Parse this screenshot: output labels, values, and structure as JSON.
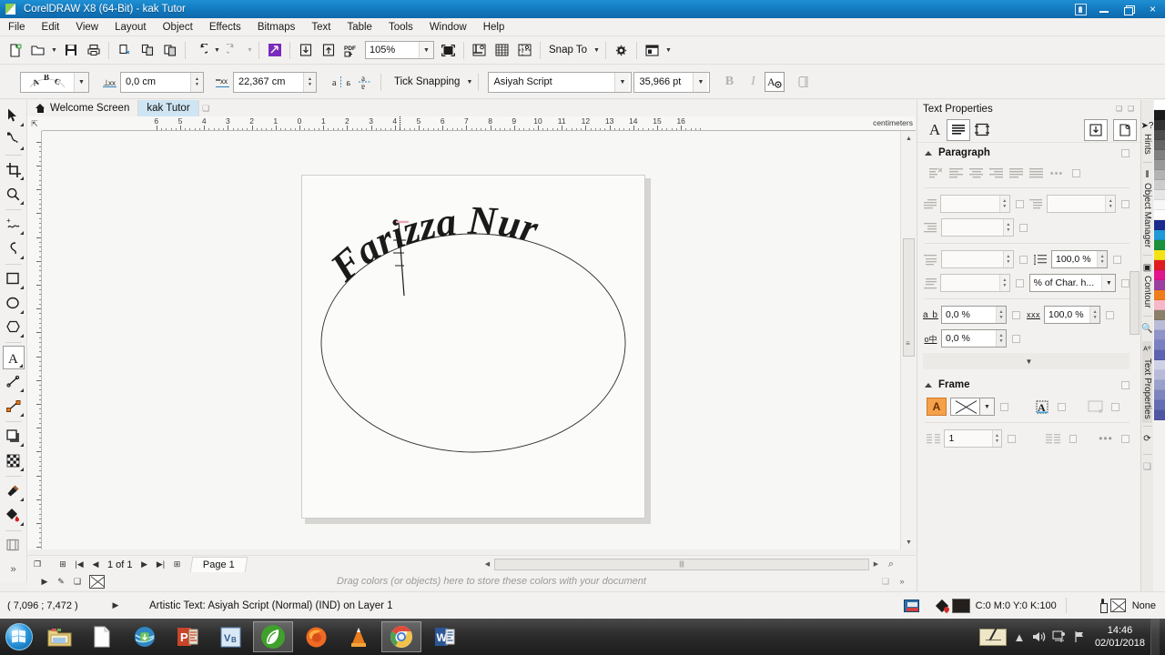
{
  "window": {
    "title": "CorelDRAW X8 (64-Bit) - kak Tutor",
    "logo_icon": "coreldraw-logo-icon",
    "buttons": {
      "user": "user-account-icon",
      "minimize": "minimize-icon",
      "restore": "restore-icon",
      "close": "×"
    }
  },
  "menubar": {
    "items": [
      {
        "label": "File"
      },
      {
        "label": "Edit"
      },
      {
        "label": "View"
      },
      {
        "label": "Layout"
      },
      {
        "label": "Object"
      },
      {
        "label": "Effects"
      },
      {
        "label": "Bitmaps"
      },
      {
        "label": "Text"
      },
      {
        "label": "Table"
      },
      {
        "label": "Tools"
      },
      {
        "label": "Window"
      },
      {
        "label": "Help"
      }
    ]
  },
  "standard_toolbar": {
    "buttons": [
      {
        "name": "new-document-button",
        "glyph": "🗋"
      },
      {
        "name": "open-document-button",
        "glyph": "🗀"
      },
      {
        "name": "save-document-button",
        "glyph": "🖫"
      },
      {
        "name": "print-button",
        "glyph": "🖨"
      },
      {
        "name": "cut-button",
        "glyph": "✂"
      },
      {
        "name": "copy-button",
        "glyph": "⧉"
      },
      {
        "name": "paste-button",
        "glyph": "📋"
      },
      {
        "name": "undo-button",
        "glyph": "↺"
      },
      {
        "name": "redo-button",
        "glyph": "↻"
      },
      {
        "name": "search-content-button",
        "glyph": "◪"
      },
      {
        "name": "import-button",
        "glyph": "⤓"
      },
      {
        "name": "export-button",
        "glyph": "⤒"
      },
      {
        "name": "publish-pdf-button",
        "glyph": "PDF"
      }
    ],
    "zoom_level": "105%",
    "zoom_placeholder": "105%",
    "fullscreen_button": "full-screen-preview-button",
    "view_buttons": [
      "show-rulers-button",
      "show-grid-button",
      "show-guidelines-button"
    ],
    "snap_to_label": "Snap To",
    "options_button": "options-gear-button",
    "launch_button": "application-launcher-button"
  },
  "property_bar": {
    "text_preset_icon": "text-on-path-preset-icon",
    "distance_from_path_label": "distance-from-path",
    "distance_from_path_value": "0,0 cm",
    "horizontal_offset_label": "horizontal-offset",
    "horizontal_offset_value": "22,367 cm",
    "mirror_horizontal": "mirror-text-horizontally",
    "mirror_vertical": "mirror-text-vertically",
    "snap_mode": "Tick Snapping",
    "font_family": "Asiyah Script",
    "font_size": "35,966 pt",
    "bold": "B",
    "italic": "I",
    "text_properties_button": "text-properties-button",
    "copy_properties_button": "copy-properties-button"
  },
  "document_tabs": {
    "tabs": [
      {
        "label": "Welcome Screen",
        "icon": "home-icon",
        "active": false
      },
      {
        "label": "kak Tutor",
        "active": true
      }
    ]
  },
  "toolbox": {
    "tools": [
      {
        "name": "pick-tool",
        "glyph": "➤",
        "selected": false
      },
      {
        "name": "shape-tool",
        "glyph": "ɕ",
        "selected": false
      },
      {
        "name": "crop-tool",
        "glyph": "⌗",
        "selected": false
      },
      {
        "name": "zoom-tool",
        "glyph": "🔍",
        "selected": false
      },
      {
        "name": "freehand-tool",
        "glyph": "〜",
        "selected": false
      },
      {
        "name": "smart-drawing-tool",
        "glyph": "~",
        "selected": false
      },
      {
        "name": "rectangle-tool",
        "glyph": "▢",
        "selected": false
      },
      {
        "name": "ellipse-tool",
        "glyph": "◯",
        "selected": false
      },
      {
        "name": "polygon-tool",
        "glyph": "⬡",
        "selected": false
      },
      {
        "name": "text-tool",
        "glyph": "A",
        "selected": true
      },
      {
        "name": "parallel-dimension-tool",
        "glyph": "⟋",
        "selected": false
      },
      {
        "name": "straight-line-connector-tool",
        "glyph": "⟋",
        "selected": false
      },
      {
        "name": "drop-shadow-tool",
        "glyph": "❏",
        "selected": false
      },
      {
        "name": "transparency-tool",
        "glyph": "▦",
        "selected": false
      },
      {
        "name": "color-eyedropper-tool",
        "glyph": "🖉",
        "selected": false
      },
      {
        "name": "interactive-fill-tool",
        "glyph": "◆",
        "selected": false
      },
      {
        "name": "smart-fill-tool",
        "glyph": "◫",
        "selected": false
      }
    ],
    "overflow": "»"
  },
  "rulers": {
    "unit": "centimeters",
    "horizontal_labels": [
      "6",
      "4",
      "2",
      "0",
      "2",
      "4",
      "6",
      "8",
      "10",
      "12",
      "14",
      "16"
    ],
    "vertical_labels": []
  },
  "canvas": {
    "artwork_text": "Farizza Nur",
    "shape": "ellipse-path",
    "page_background": "#fbfbf9"
  },
  "page_navigator": {
    "first_page_icon": "first-page-icon",
    "prev_page_icon": "previous-page-icon",
    "page_counter": "1  of  1",
    "next_page_icon": "next-page-icon",
    "last_page_icon": "last-page-icon",
    "add_page_icon": "add-page-icon",
    "page_tab": "Page 1"
  },
  "palette_bar": {
    "hint": "Drag colors (or objects) here to store these colors with your document",
    "no_color": "no-color-swatch"
  },
  "status_bar": {
    "coordinates": "( 7,096 ; 7,472 )",
    "object_info": "Artistic Text: Asiyah Script (Normal) (IND) on Layer 1",
    "fill_color": "C:0 M:0 Y:0 K:100",
    "fill_swatch_hex": "#231f1c",
    "outline": "None"
  },
  "docker": {
    "title": "Text Properties",
    "mode_buttons": [
      {
        "name": "character-mode-button",
        "glyph": "A",
        "active": false
      },
      {
        "name": "paragraph-mode-button",
        "glyph": "▤",
        "active": true
      },
      {
        "name": "frame-mode-button",
        "glyph": "⬚",
        "active": false
      }
    ],
    "right_buttons": [
      {
        "name": "import-text-styles-button",
        "glyph": "⤓"
      },
      {
        "name": "new-text-style-button",
        "glyph": "🗋"
      }
    ],
    "paragraph": {
      "heading": "Paragraph",
      "align_buttons": [
        "align-none-button",
        "align-left-button",
        "align-center-button",
        "align-right-button",
        "align-full-justify-button",
        "align-force-justify-button",
        "more-align-options-button"
      ],
      "first_line_indent_value": "",
      "first_line_indent_placeholder": "",
      "left_indent_value": "",
      "right_indent_value": "",
      "space_before_value": "",
      "space_after_value": "",
      "line_spacing_value": "100,0 %",
      "line_spacing_unit": "% of Char. h...",
      "character_spacing_label": "a b",
      "character_spacing_value": "0,0 %",
      "word_spacing_label": "xxx",
      "word_spacing_value": "100,0 %",
      "language_spacing_label": "o中",
      "language_spacing_value": "0,0 %",
      "expand_glyph": "▼"
    },
    "frame": {
      "heading": "Frame",
      "fill_button": "frame-fill-button",
      "no_frame_value": "no-frame-x",
      "vertical_align_button": "vertical-alignment-button",
      "text_wrap_button": "text-wrap-button",
      "columns_value": "1",
      "columns_button": "columns-settings-button",
      "more_button": "more-frame-options-button"
    }
  },
  "vertical_dock": {
    "tabs": [
      {
        "label": "Hints",
        "icon": "pointer-question-icon",
        "selected": false
      },
      {
        "label": "Object Manager",
        "icon": "layers-icon",
        "selected": false
      },
      {
        "label": "Contour",
        "icon": "contour-icon",
        "selected": false
      },
      {
        "label": "",
        "icon": "find-icon",
        "selected": false
      },
      {
        "label": "Text Properties",
        "icon": "text-properties-icon",
        "selected": true
      },
      {
        "label": "",
        "icon": "transform-icon",
        "selected": false
      },
      {
        "label": "",
        "icon": "object-properties-icon",
        "selected": false
      }
    ]
  },
  "color_palette": {
    "swatches": [
      "#ffffff",
      "#1a1a1a",
      "#333333",
      "#4d4d4d",
      "#666666",
      "#808080",
      "#999999",
      "#b3b3b3",
      "#cccccc",
      "#e6e6e6",
      "#f7f7f7",
      "#fdfdfd",
      "#1b2a8f",
      "#1e9ad6",
      "#1a8f3c",
      "#f5e215",
      "#e11a22",
      "#e3158c",
      "#9b3fa0",
      "#ef7d1a",
      "#f6b8c8",
      "#8a7f6a",
      "#b9bcd8",
      "#8f93c9",
      "#7a7fc2",
      "#5d63b0"
    ]
  },
  "taskbar": {
    "start_button": "windows-start-orb",
    "items": [
      {
        "name": "file-explorer-icon",
        "glyph": "🗂",
        "active": false
      },
      {
        "name": "text-document-icon",
        "glyph": "📄",
        "active": false
      },
      {
        "name": "internet-download-manager-icon",
        "glyph": "🌐",
        "active": false
      },
      {
        "name": "powerpoint-icon",
        "glyph": "P",
        "active": false
      },
      {
        "name": "visio-icon",
        "glyph": "V",
        "active": false
      },
      {
        "name": "coreldraw-icon",
        "glyph": "🍃",
        "active": true
      },
      {
        "name": "firefox-icon",
        "glyph": "🦊",
        "active": false
      },
      {
        "name": "vlc-icon",
        "glyph": "▲",
        "active": false
      },
      {
        "name": "chrome-icon",
        "glyph": "◉",
        "active": true
      },
      {
        "name": "word-icon",
        "glyph": "W",
        "active": false
      }
    ],
    "tray": {
      "tablet_icon": "ink-tablet-icon",
      "show_hidden_icon": "▲",
      "volume_icon": "🔊",
      "network_icon": "🖧",
      "action_icon": "⚑",
      "time": "14:46",
      "date": "02/01/2018"
    }
  }
}
